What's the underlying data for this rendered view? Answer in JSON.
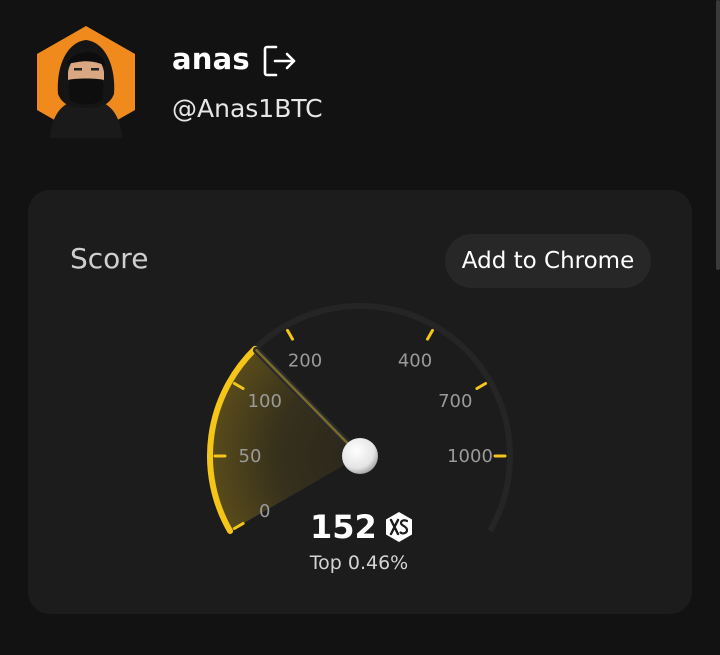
{
  "profile": {
    "name": "anas",
    "handle": "@Anas1BTC",
    "avatar_accent": "#f08a1c"
  },
  "score_card": {
    "title": "Score",
    "add_to_chrome_label": "Add to Chrome",
    "score": "152",
    "rank_text": "Top 0.46%",
    "gauge": {
      "value": 152,
      "ticks": [
        "0",
        "50",
        "100",
        "200",
        "400",
        "700",
        "1000"
      ],
      "active_color": "#f5c518",
      "track_color": "#252525"
    }
  },
  "icons": [
    "logout-icon",
    "xs-logo-icon",
    "avatar-image"
  ]
}
